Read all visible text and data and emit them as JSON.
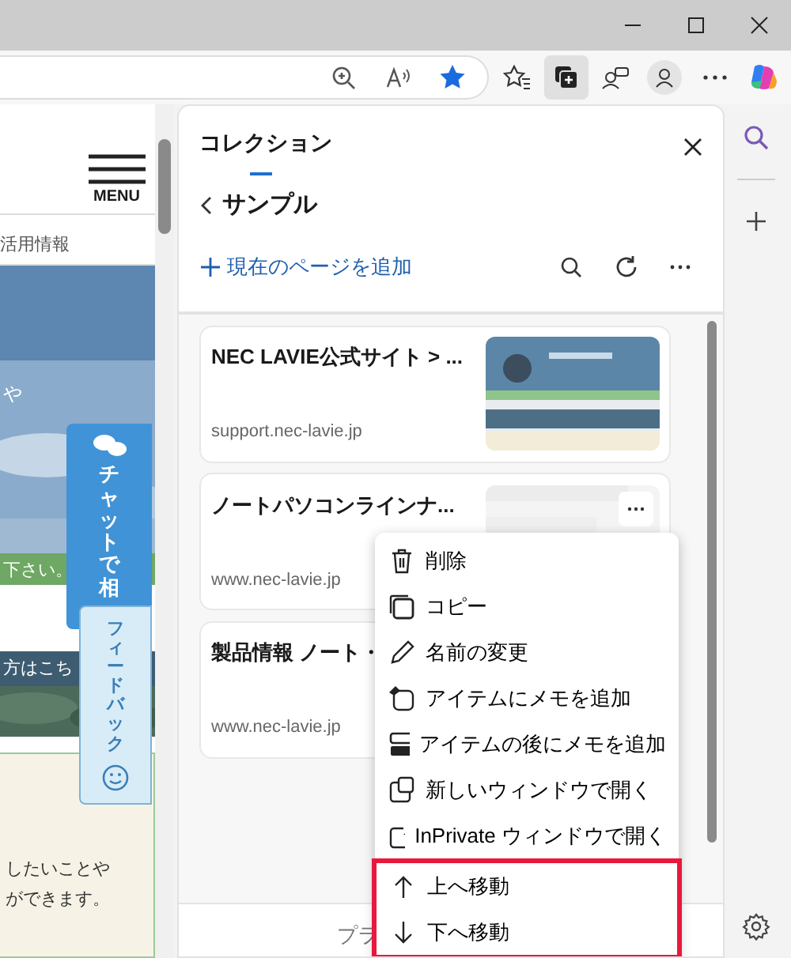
{
  "toolbar": {
    "page_favorited": true,
    "collections_active": true
  },
  "page": {
    "menu_label": "MENU",
    "nav_text": "活用情報",
    "hero_text": "や",
    "notice": "下さい。",
    "chat_button": "チャットで相",
    "feedback_button": "フィードバック",
    "band_text": "方はこち",
    "info_lines": [
      "したいことや",
      "ができます。"
    ]
  },
  "collections": {
    "title": "コレクション",
    "name": "サンプル",
    "add_label": "現在のページを追加",
    "items": [
      {
        "title": "NEC LAVIE公式サイト > ...",
        "url": "support.nec-lavie.jp",
        "menu_open": false
      },
      {
        "title": "ノートパソコンラインナ...",
        "url": "www.nec-lavie.jp",
        "menu_open": true
      },
      {
        "title": "製品情報 ノート・",
        "url": "www.nec-lavie.jp",
        "menu_open": false
      }
    ],
    "footer": "プラ"
  },
  "context_menu": {
    "items": [
      {
        "kind": "delete",
        "label": "削除",
        "highlighted": false
      },
      {
        "kind": "copy",
        "label": "コピー",
        "highlighted": false
      },
      {
        "kind": "rename",
        "label": "名前の変更",
        "highlighted": false
      },
      {
        "kind": "note",
        "label": "アイテムにメモを追加",
        "highlighted": false
      },
      {
        "kind": "note-after",
        "label": "アイテムの後にメモを追加",
        "highlighted": false
      },
      {
        "kind": "new-window",
        "label": "新しいウィンドウで開く",
        "highlighted": false
      },
      {
        "kind": "inprivate",
        "label": "InPrivate ウィンドウで開く",
        "highlighted": false
      },
      {
        "kind": "move-up",
        "label": "上へ移動",
        "highlighted": true
      },
      {
        "kind": "move-down",
        "label": "下へ移動",
        "highlighted": true
      }
    ]
  }
}
